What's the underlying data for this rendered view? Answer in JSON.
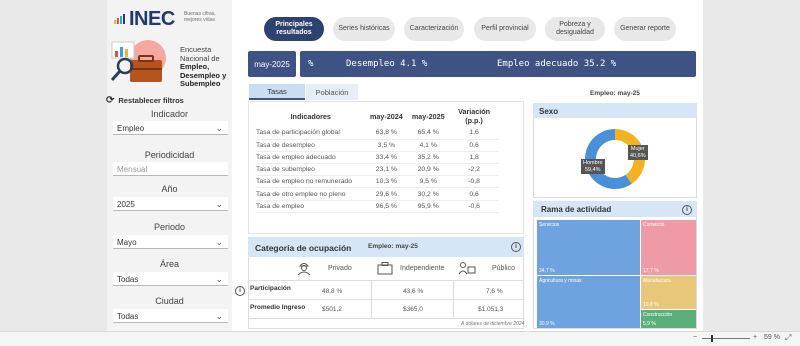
{
  "brand": {
    "logo_text": "INEC",
    "logo_sub1": "Buenas cifras,",
    "logo_sub2": "mejores vidas"
  },
  "survey": {
    "line1": "Encuesta",
    "line2": "Nacional de",
    "line3": "Empleo,",
    "line4": "Desempleo y",
    "line5": "Subempleo"
  },
  "filters": {
    "reset_label": "Restablecer filtros",
    "indicador_label": "Indicador",
    "indicador_value": "Empleo",
    "periodicidad_label": "Periodicidad",
    "periodicidad_placeholder": "Mensual",
    "anio_label": "Año",
    "anio_value": "2025",
    "periodo_label": "Periodo",
    "periodo_value": "Mayo",
    "area_label": "Área",
    "area_value": "Todas",
    "ciudad_label": "Ciudad",
    "ciudad_value": "Todas"
  },
  "nav": {
    "principales1": "Principales",
    "principales2": "resultados",
    "series": "Series históricas",
    "caracterizacion": "Caracterización",
    "perfil": "Perfil provincial",
    "pobreza1": "Pobreza y",
    "pobreza2": "desigualdad",
    "reporte": "Generar reporte"
  },
  "banner": {
    "period": "may-2025",
    "pct": "%",
    "desempleo": "Desempleo 4.1 %",
    "empleo": "Empleo adecuado 35.2 %"
  },
  "subtabs": {
    "tasas": "Tasas",
    "poblacion": "Población"
  },
  "indicators": {
    "headers": {
      "name": "Indicadores",
      "prev": "may-2024",
      "curr": "may-2025",
      "var": "Variación (p.p.)"
    },
    "rows": [
      {
        "name": "Tasa de participación global",
        "prev": "63,8 %",
        "curr": "65,4 %",
        "var": "1,6"
      },
      {
        "name": "Tasa de desempleo",
        "prev": "3,5 %",
        "curr": "4,1 %",
        "var": "0,6"
      },
      {
        "name": "Tasa de empleo adecuado",
        "prev": "33,4 %",
        "curr": "35,2 %",
        "var": "1,8"
      },
      {
        "name": "Tasa de subempleo",
        "prev": "23,1 %",
        "curr": "20,9 %",
        "var": "-2,2"
      },
      {
        "name": "Tasa de empleo no remunerado",
        "prev": "10,3 %",
        "curr": "9,5 %",
        "var": "-0,8"
      },
      {
        "name": "Tasa de otro empleo no pleno",
        "prev": "29,6 %",
        "curr": "30,2 %",
        "var": "0,6"
      },
      {
        "name": "Tasa de empleo",
        "prev": "96,5 %",
        "curr": "95,9 %",
        "var": "-0,6"
      }
    ]
  },
  "right_caption": "Empleo: may-25",
  "sexo": {
    "title": "Sexo",
    "hombre_label": "Hombre",
    "hombre_value": "59,4%",
    "mujer_label": "Mujer",
    "mujer_value": "40,6%",
    "hombre_frac": 0.594,
    "colors": {
      "hombre": "#4a90d9",
      "mujer": "#f4b223"
    }
  },
  "rama": {
    "title": "Rama de actividad",
    "tiles": [
      {
        "label": "Servicios",
        "value": "34,7 %",
        "color": "#6fa3e0"
      },
      {
        "label": "Comercio",
        "value": "17,7 %",
        "color": "#ef9aa7"
      },
      {
        "label": "Agricultura y minas",
        "value": "30,9 %",
        "color": "#6fa3e0"
      },
      {
        "label": "Manufactura",
        "value": "10,8 %",
        "color": "#e9c77a"
      },
      {
        "label": "Construcción",
        "value": "5,9 %",
        "color": "#5bb07a"
      }
    ]
  },
  "ocupacion": {
    "title": "Categoría de ocupación",
    "caption": "Empleo: may-25",
    "cols": [
      "Privado",
      "Independiente",
      "Público"
    ],
    "rows": [
      {
        "label": "Participación",
        "values": [
          "48,8 %",
          "43,6 %",
          "7,6 %"
        ]
      },
      {
        "label": "Promedio Ingreso",
        "values": [
          "$501,2",
          "$365,0",
          "$1.051,3"
        ]
      }
    ],
    "footnote": "A dólares de diciembre 2024"
  },
  "status": {
    "zoom": "59 %"
  }
}
